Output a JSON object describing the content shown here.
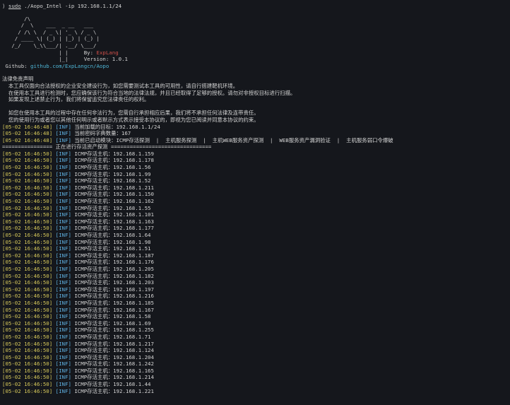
{
  "command": {
    "prompt": "⟩ ",
    "sudo": "sudo",
    "rest": " ./Aopo_Intel -ip 192.168.1.1/24"
  },
  "banner": {
    "ascii": [
      "       /\\",
      "      /  \\    ___  _ __   ___",
      "     / /\\ \\  / _ \\| '_ \\ / _ \\",
      "    / ____ \\| (_) | |_) | (_) |",
      "   /_/    \\_\\\\___/| .__/ \\___/",
      "                  | |     By: "
    ],
    "by_name": "ExpLang",
    "version_prefix": "                  |_|     ",
    "version": "Version: 1.0.1",
    "github_label": " Github: ",
    "github_url": "github.com/ExpLangcn/Aopo"
  },
  "disclaimer": {
    "title": "法律免责声明",
    "lines": [
      "  本工具仅面向合法授权的企业安全建设行为，如您需要测试本工具的可用性，请自行搭建靶机环境。",
      "  在使用本工具进行检测时，您应确保该行为符合当地的法律法规，并且已经取得了足够的授权。请勿对非授权目标进行扫描。",
      "  如果发现上述禁止行为，我们将保留追究您法律责任的权利。",
      "",
      "  如您在使用本工具的过程中存在任何非法行为，您需自行承担相应后果，我们将不承担任何法律及连带责任。",
      "  您的使用行为或者您以其他任何明示或者默示方式表示接受本协议的，即视为您已阅读并同意本协议的约束。"
    ]
  },
  "info_lines": [
    {
      "ts": "[05-02 16:46:48]",
      "tag": "[INF]",
      "msg": " 当前加载的目标：192.168.1.1/24"
    },
    {
      "ts": "[05-02 16:46:48]",
      "tag": "[INF]",
      "msg": " 当前密码字典数量：167"
    },
    {
      "ts": "[05-02 16:46:48]",
      "tag": "[INF]",
      "msg": " 当前已启动模块：ICMP存活探测  |  主机服务探测  |  主机WEB服务资产探测  |  WEB服务资产漏洞验证  |  主机服务弱口令爆破"
    }
  ],
  "separator": "================ 正在进行存活资产探测 ================================",
  "scan_lines": [
    {
      "ts": "[05-02 16:46:50]",
      "tag": "[INF]",
      "msg": " ICMP存活主机：192.168.1.159"
    },
    {
      "ts": "[05-02 16:46:50]",
      "tag": "[INF]",
      "msg": " ICMP存活主机：192.168.1.178"
    },
    {
      "ts": "[05-02 16:46:50]",
      "tag": "[INF]",
      "msg": " ICMP存活主机：192.168.1.56"
    },
    {
      "ts": "[05-02 16:46:50]",
      "tag": "[INF]",
      "msg": " ICMP存活主机：192.168.1.99"
    },
    {
      "ts": "[05-02 16:46:50]",
      "tag": "[INF]",
      "msg": " ICMP存活主机：192.168.1.52"
    },
    {
      "ts": "[05-02 16:46:50]",
      "tag": "[INF]",
      "msg": " ICMP存活主机：192.168.1.211"
    },
    {
      "ts": "[05-02 16:46:50]",
      "tag": "[INF]",
      "msg": " ICMP存活主机：192.168.1.150"
    },
    {
      "ts": "[05-02 16:46:50]",
      "tag": "[INF]",
      "msg": " ICMP存活主机：192.168.1.162"
    },
    {
      "ts": "[05-02 16:46:50]",
      "tag": "[INF]",
      "msg": " ICMP存活主机：192.168.1.55"
    },
    {
      "ts": "[05-02 16:46:50]",
      "tag": "[INF]",
      "msg": " ICMP存活主机：192.168.1.101"
    },
    {
      "ts": "[05-02 16:46:50]",
      "tag": "[INF]",
      "msg": " ICMP存活主机：192.168.1.163"
    },
    {
      "ts": "[05-02 16:46:50]",
      "tag": "[INF]",
      "msg": " ICMP存活主机：192.168.1.177"
    },
    {
      "ts": "[05-02 16:46:50]",
      "tag": "[INF]",
      "msg": " ICMP存活主机：192.168.1.64"
    },
    {
      "ts": "[05-02 16:46:50]",
      "tag": "[INF]",
      "msg": " ICMP存活主机：192.168.1.98"
    },
    {
      "ts": "[05-02 16:46:50]",
      "tag": "[INF]",
      "msg": " ICMP存活主机：192.168.1.51"
    },
    {
      "ts": "[05-02 16:46:50]",
      "tag": "[INF]",
      "msg": " ICMP存活主机：192.168.1.187"
    },
    {
      "ts": "[05-02 16:46:50]",
      "tag": "[INF]",
      "msg": " ICMP存活主机：192.168.1.176"
    },
    {
      "ts": "[05-02 16:46:50]",
      "tag": "[INF]",
      "msg": " ICMP存活主机：192.168.1.205"
    },
    {
      "ts": "[05-02 16:46:50]",
      "tag": "[INF]",
      "msg": " ICMP存活主机：192.168.1.182"
    },
    {
      "ts": "[05-02 16:46:50]",
      "tag": "[INF]",
      "msg": " ICMP存活主机：192.168.1.203"
    },
    {
      "ts": "[05-02 16:46:50]",
      "tag": "[INF]",
      "msg": " ICMP存活主机：192.168.1.197"
    },
    {
      "ts": "[05-02 16:46:50]",
      "tag": "[INF]",
      "msg": " ICMP存活主机：192.168.1.216"
    },
    {
      "ts": "[05-02 16:46:50]",
      "tag": "[INF]",
      "msg": " ICMP存活主机：192.168.1.185"
    },
    {
      "ts": "[05-02 16:46:50]",
      "tag": "[INF]",
      "msg": " ICMP存活主机：192.168.1.167"
    },
    {
      "ts": "[05-02 16:46:50]",
      "tag": "[INF]",
      "msg": " ICMP存活主机：192.168.1.58"
    },
    {
      "ts": "[05-02 16:46:50]",
      "tag": "[INF]",
      "msg": " ICMP存活主机：192.168.1.69"
    },
    {
      "ts": "[05-02 16:46:50]",
      "tag": "[INF]",
      "msg": " ICMP存活主机：192.168.1.255"
    },
    {
      "ts": "[05-02 16:46:50]",
      "tag": "[INF]",
      "msg": " ICMP存活主机：192.168.1.71"
    },
    {
      "ts": "[05-02 16:46:50]",
      "tag": "[INF]",
      "msg": " ICMP存活主机：192.168.1.217"
    },
    {
      "ts": "[05-02 16:46:50]",
      "tag": "[INF]",
      "msg": " ICMP存活主机：192.168.1.124"
    },
    {
      "ts": "[05-02 16:46:50]",
      "tag": "[INF]",
      "msg": " ICMP存活主机：192.168.1.204"
    },
    {
      "ts": "[05-02 16:46:50]",
      "tag": "[INF]",
      "msg": " ICMP存活主机：192.168.1.242"
    },
    {
      "ts": "[05-02 16:46:50]",
      "tag": "[INF]",
      "msg": " ICMP存活主机：192.168.1.165"
    },
    {
      "ts": "[05-02 16:46:50]",
      "tag": "[INF]",
      "msg": " ICMP存活主机：192.168.1.214"
    },
    {
      "ts": "[05-02 16:46:50]",
      "tag": "[INF]",
      "msg": " ICMP存活主机：192.168.1.44"
    },
    {
      "ts": "[05-02 16:46:50]",
      "tag": "[INF]",
      "msg": " ICMP存活主机：192.168.1.221"
    }
  ],
  "colors": {
    "background": "#15171c",
    "timestamp": "#d6c85a",
    "tag": "#5fb0e0",
    "author": "#d0504a",
    "link": "#4fb6d6"
  }
}
